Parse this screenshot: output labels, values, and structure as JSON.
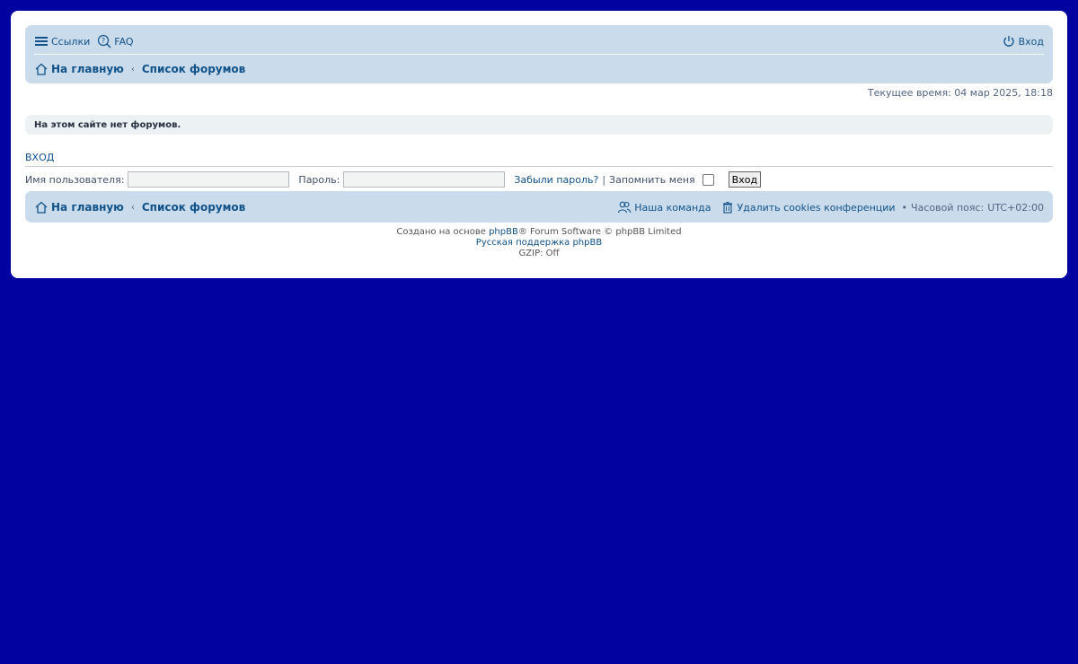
{
  "header": {
    "links_label": "Ссылки",
    "faq_label": "FAQ",
    "login_label": "Вход"
  },
  "breadcrumb": {
    "home": "На главную",
    "forums": "Список форумов"
  },
  "current_time": "Текущее время: 04 мар 2025, 18:18",
  "notice": "На этом сайте нет форумов.",
  "login": {
    "heading": "Вход",
    "username_label": "Имя пользователя:",
    "password_label": "Пароль:",
    "username_value": "",
    "password_value": "",
    "forgot_label": "Забыли пароль?",
    "separator": "|",
    "remember_label": "Запомнить меня",
    "submit_label": "Вход"
  },
  "footer_nav": {
    "team_label": "Наша команда",
    "delete_cookies_label": "Удалить cookies конференции",
    "timezone_label": "Часовой пояс:",
    "timezone_value": "UTC+02:00"
  },
  "copyright": {
    "prefix": "Создано на основе",
    "phpbb_link": "phpBB",
    "suffix": "® Forum Software © phpBB Limited",
    "support_link": "Русская поддержка phpBB",
    "gzip": "GZIP: Off"
  },
  "colors": {
    "page_background": "#0202a0",
    "navbar": "#cadceb",
    "link": "#105289"
  }
}
